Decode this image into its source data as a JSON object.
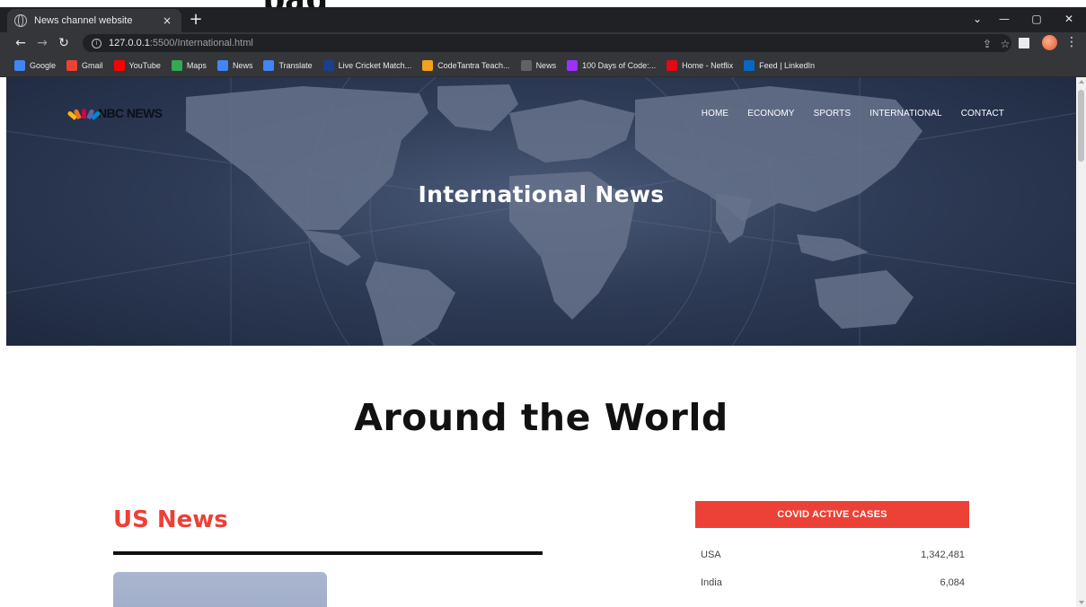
{
  "browser": {
    "tab_title": "News channel website",
    "tab_close": "×",
    "new_tab": "+",
    "url_host": "127.0.0.1",
    "url_rest": ":5500/International.html",
    "bookmarks": [
      {
        "label": "Google",
        "icon": "google-icon",
        "color": "#4285f4"
      },
      {
        "label": "Gmail",
        "icon": "gmail-icon",
        "color": "#ea4335"
      },
      {
        "label": "YouTube",
        "icon": "youtube-icon",
        "color": "#ff0000"
      },
      {
        "label": "Maps",
        "icon": "maps-icon",
        "color": "#34a853"
      },
      {
        "label": "News",
        "icon": "news-icon",
        "color": "#4285f4"
      },
      {
        "label": "Translate",
        "icon": "translate-icon",
        "color": "#4285f4"
      },
      {
        "label": "Live Cricket Match...",
        "icon": "cricket-icon",
        "color": "#1a3f8f"
      },
      {
        "label": "CodeTantra Teach...",
        "icon": "codetantra-icon",
        "color": "#f4a11d"
      },
      {
        "label": "News",
        "icon": "globe-icon",
        "color": "#5f6368"
      },
      {
        "label": "100 Days of Code:...",
        "icon": "code-icon",
        "color": "#9b30ff"
      },
      {
        "label": "Home - Netflix",
        "icon": "netflix-icon",
        "color": "#e50914"
      },
      {
        "label": "Feed | LinkedIn",
        "icon": "linkedin-icon",
        "color": "#0a66c2"
      }
    ]
  },
  "site": {
    "logo_text": "NBC NEWS",
    "nav": [
      "HOME",
      "ECONOMY",
      "SPORTS",
      "INTERNATIONAL",
      "CONTACT"
    ],
    "hero_title": "International News",
    "section_title": "Around the World",
    "us_news": "US News",
    "covid": {
      "header": "COVID ACTIVE CASES",
      "rows": [
        {
          "country": "USA",
          "cases": "1,342,481"
        },
        {
          "country": "India",
          "cases": "6,084"
        }
      ]
    }
  },
  "colors": {
    "accent": "#ed4036",
    "hero_bg": "#2f3c57",
    "browser_dark": "#202124"
  }
}
